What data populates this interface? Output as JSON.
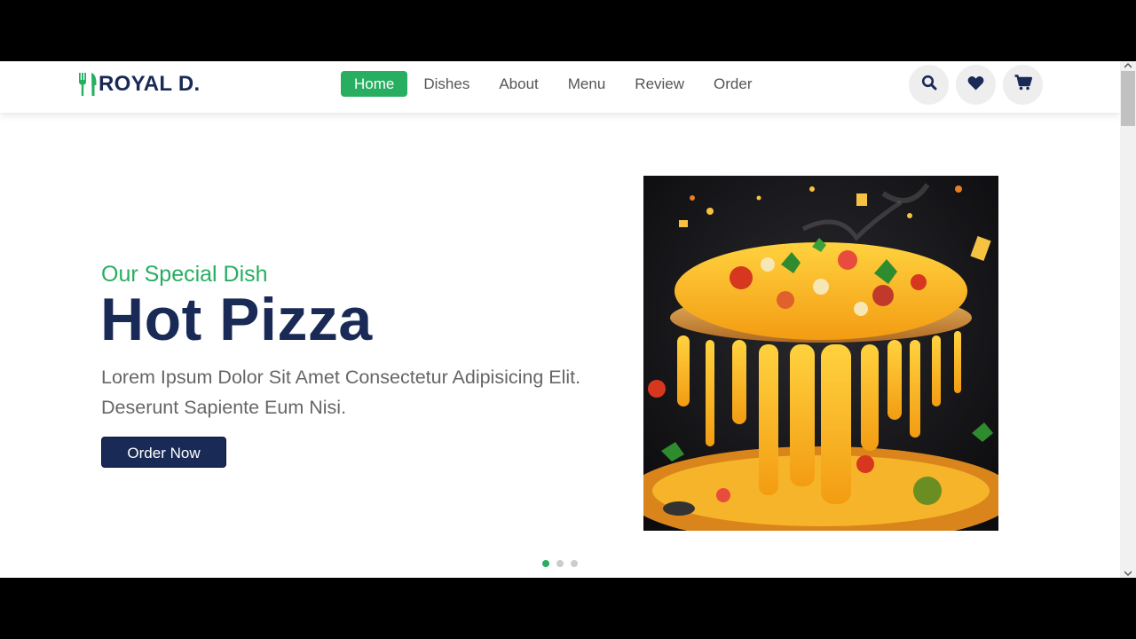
{
  "header": {
    "logo_text": "ROYAL D.",
    "logo_icon": "utensils-icon",
    "nav": [
      {
        "label": "Home",
        "active": true
      },
      {
        "label": "Dishes",
        "active": false
      },
      {
        "label": "About",
        "active": false
      },
      {
        "label": "Menu",
        "active": false
      },
      {
        "label": "Review",
        "active": false
      },
      {
        "label": "Order",
        "active": false
      }
    ],
    "icons": [
      "search-icon",
      "heart-icon",
      "cart-icon"
    ]
  },
  "hero": {
    "subtitle": "Our Special Dish",
    "title": "Hot Pizza",
    "description": "Lorem Ipsum Dolor Sit Amet Consectetur Adipisicing Elit. Deserunt Sapiente Eum Nisi.",
    "button_label": "Order Now",
    "image_subject": "pizza with melting cheese",
    "slides": 3,
    "active_slide": 1
  },
  "colors": {
    "accent_green": "#27ae60",
    "brand_navy": "#192a56",
    "body_text": "#666666"
  }
}
